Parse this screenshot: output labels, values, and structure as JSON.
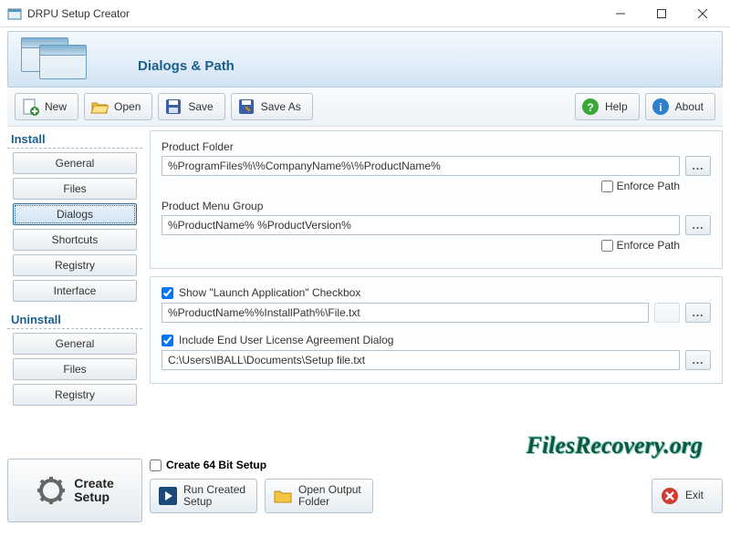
{
  "window": {
    "title": "DRPU Setup Creator"
  },
  "banner": {
    "title": "Dialogs & Path"
  },
  "toolbar": {
    "new": "New",
    "open": "Open",
    "save": "Save",
    "saveas": "Save As",
    "help": "Help",
    "about": "About"
  },
  "sidebar": {
    "install_head": "Install",
    "install": [
      "General",
      "Files",
      "Dialogs",
      "Shortcuts",
      "Registry",
      "Interface"
    ],
    "uninstall_head": "Uninstall",
    "uninstall": [
      "General",
      "Files",
      "Registry"
    ]
  },
  "form": {
    "product_folder_label": "Product Folder",
    "product_folder_value": "%ProgramFiles%\\%CompanyName%\\%ProductName%",
    "enforce_path": "Enforce Path",
    "menu_group_label": "Product Menu Group",
    "menu_group_value": "%ProductName% %ProductVersion%",
    "show_launch": "Show \"Launch Application\" Checkbox",
    "launch_value": "%ProductName%%InstallPath%\\File.txt",
    "eula": "Include End User License Agreement Dialog",
    "eula_value": "C:\\Users\\IBALL\\Documents\\Setup file.txt",
    "browse": "..."
  },
  "bottom": {
    "create_setup": "Create\nSetup",
    "cb64": "Create 64 Bit Setup",
    "run": "Run Created\nSetup",
    "openout": "Open Output\nFolder",
    "exit": "Exit"
  },
  "watermark": "FilesRecovery.org"
}
